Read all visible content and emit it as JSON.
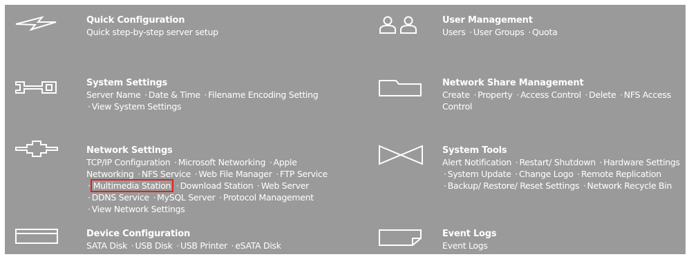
{
  "items": {
    "quick_config": {
      "title": "Quick Configuration",
      "links": [
        "Quick step-by-step server setup"
      ],
      "icon": "lightning-icon"
    },
    "user_mgmt": {
      "title": "User Management",
      "links": [
        "Users",
        "User Groups",
        "Quota"
      ],
      "icon": "users-icon"
    },
    "system_settings": {
      "title": "System Settings",
      "links": [
        "Server Name",
        "Date & Time",
        "Filename Encoding Setting",
        "View System Settings"
      ],
      "icon": "wrench-icon"
    },
    "network_share": {
      "title": "Network Share Management",
      "links": [
        "Create",
        "Property",
        "Access Control",
        "Delete",
        "NFS Access Control"
      ],
      "icon": "folder-icon"
    },
    "network_settings": {
      "title": "Network Settings",
      "links": [
        "TCP/IP Configuration",
        "Microsoft Networking",
        "Apple Networking",
        "NFS Service",
        "Web File Manager",
        "FTP Service",
        "Multimedia Station",
        "Download Station",
        "Web Server",
        "DDNS Service",
        "MySQL Server",
        "Protocol Management",
        "View Network Settings"
      ],
      "highlighted": "Multimedia Station",
      "icon": "network-icon"
    },
    "system_tools": {
      "title": "System Tools",
      "links": [
        "Alert Notification",
        "Restart/ Shutdown",
        "Hardware Settings",
        "System Update",
        "Change Logo",
        "Remote Replication",
        "Backup/ Restore/ Reset Settings",
        "Network Recycle Bin"
      ],
      "icon": "bowtie-icon"
    },
    "device_config": {
      "title": "Device Configuration",
      "links": [
        "SATA Disk",
        "USB Disk",
        "USB Printer",
        "eSATA Disk"
      ],
      "icon": "disk-icon"
    },
    "event_logs": {
      "title": "Event Logs",
      "links": [
        "Event Logs"
      ],
      "icon": "log-icon"
    }
  },
  "separator": "·",
  "colors": {
    "panel": "#9a9a9a",
    "text": "#ffffff",
    "highlight": "#e02020"
  }
}
